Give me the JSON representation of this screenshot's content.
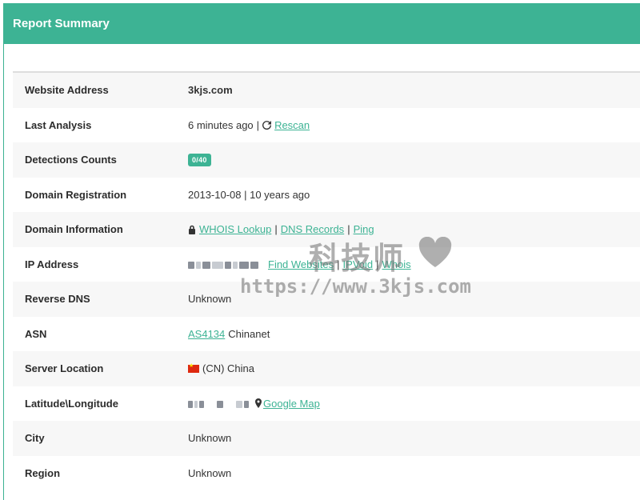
{
  "header": {
    "title": "Report Summary"
  },
  "rows": [
    {
      "label": "Website Address",
      "value": "3kjs.com"
    },
    {
      "label": "Last Analysis",
      "time": "6 minutes ago",
      "rescan": "Rescan"
    },
    {
      "label": "Detections Counts",
      "badge": "0/40"
    },
    {
      "label": "Domain Registration",
      "value": "2013-10-08 | 10 years ago"
    },
    {
      "label": "Domain Information",
      "links": [
        "WHOIS Lookup",
        "DNS Records",
        "Ping"
      ]
    },
    {
      "label": "IP Address",
      "links": [
        "Find Websites",
        "IPVoid",
        "Whois"
      ]
    },
    {
      "label": "Reverse DNS",
      "value": "Unknown"
    },
    {
      "label": "ASN",
      "link": "AS4134",
      "value": "Chinanet"
    },
    {
      "label": "Server Location",
      "value": "(CN) China"
    },
    {
      "label": "Latitude\\Longitude",
      "link": "Google Map"
    },
    {
      "label": "City",
      "value": "Unknown"
    },
    {
      "label": "Region",
      "value": "Unknown"
    }
  ],
  "icons": {
    "rescan": "refresh-icon",
    "lock": "lock-icon",
    "map": "map-pin-icon",
    "flag": "china-flag-icon"
  },
  "colors": {
    "accent": "#3db394"
  },
  "watermark": {
    "title": "科技师",
    "url": "https://www.3kjs.com"
  }
}
